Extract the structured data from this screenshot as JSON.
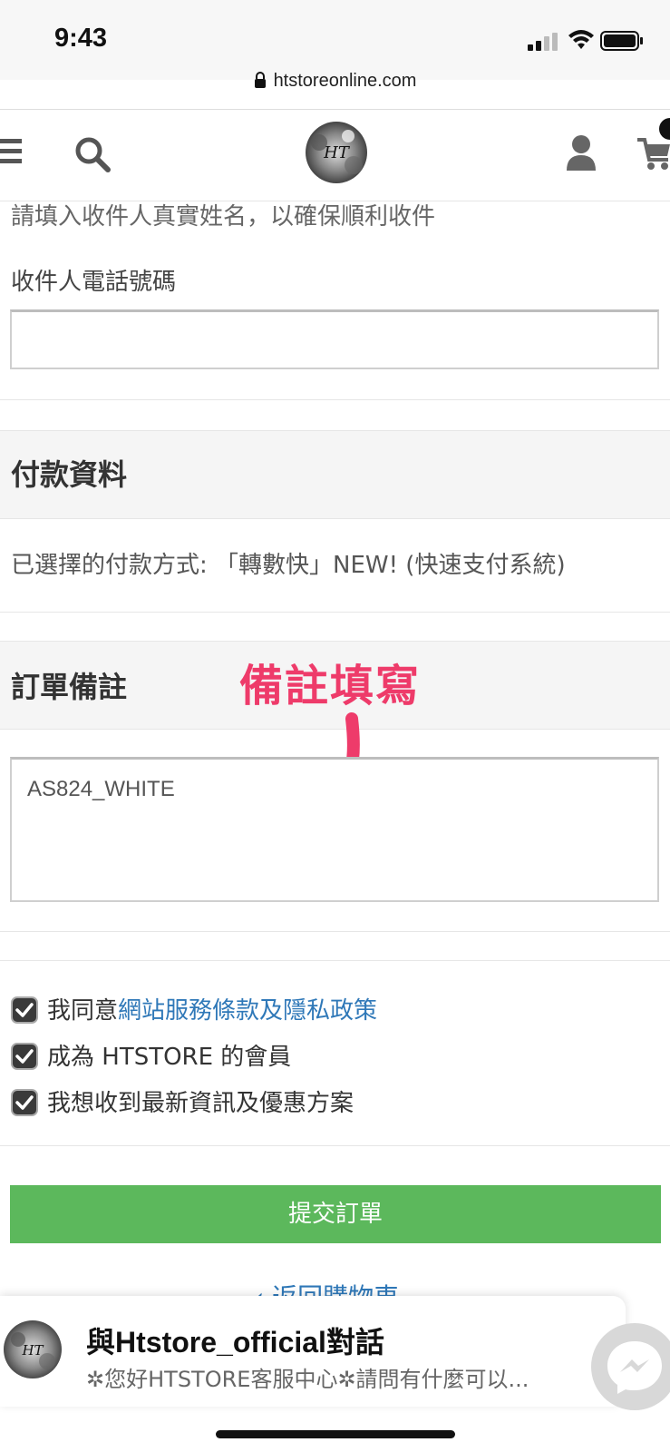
{
  "status_bar": {
    "time": "9:43",
    "url": "htstoreonline.com"
  },
  "header": {
    "logo_text": "HT"
  },
  "form": {
    "recipient_name_hint": "請填入收件人真實姓名，以確保順利收件",
    "phone_label": "收件人電話號碼",
    "phone_value": ""
  },
  "payment": {
    "title": "付款資料",
    "selected_text": "已選擇的付款方式: 「轉數快」NEW! (快速支付系統)"
  },
  "order_note": {
    "title": "訂單備註",
    "value": "AS824_WHITE",
    "annotation": "備註填寫"
  },
  "checkboxes": [
    {
      "prefix": "我同意",
      "link": "網站服務條款及隱私政策",
      "checked": true
    },
    {
      "prefix": "成為 HTSTORE 的會員",
      "link": "",
      "checked": true
    },
    {
      "prefix": "我想收到最新資訊及優惠方案",
      "link": "",
      "checked": true
    }
  ],
  "submit_label": "提交訂單",
  "back_link": "‹ 返回購物車",
  "messenger": {
    "title": "與Htstore_official對話",
    "subtitle": "✲您好HTSTORE客服中心✲請問有什麼可以..."
  },
  "colors": {
    "accent_green": "#5cb85c",
    "link_blue": "#2f78b8",
    "annotation_pink": "#ee3b6a"
  }
}
